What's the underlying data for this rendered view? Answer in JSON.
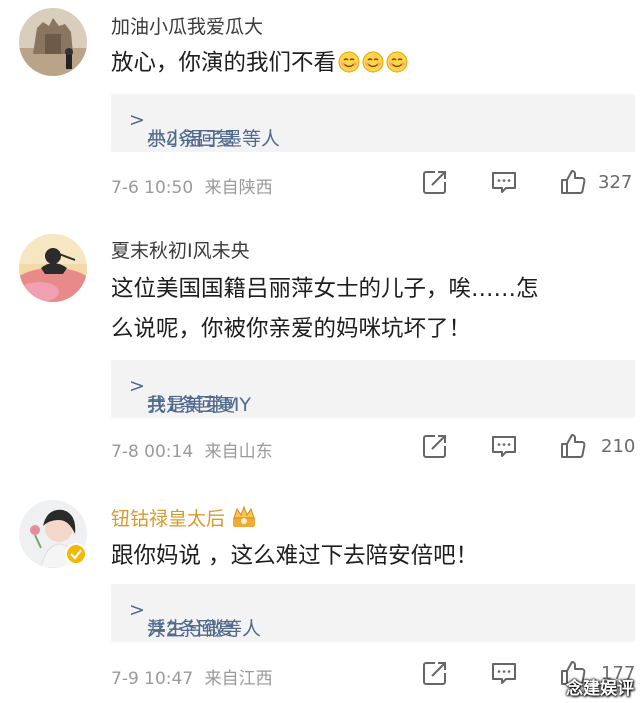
{
  "comments": [
    {
      "username": "加油小瓜我爱瓜大",
      "content": "放心，你演的我们不看",
      "emoji_count": 3,
      "replies_users": "小小温子墨等人",
      "replies_count": "共2条回复",
      "chevron": ">",
      "time": "7-6 10:50",
      "location": "来自陕西",
      "likes": "327"
    },
    {
      "username": "夏末秋初I风未央",
      "content_line1": "这位美国国籍吕丽萍女士的儿子，唉……怎",
      "content_line2": "么说呢，你被你亲爱的妈咪坑坏了！",
      "replies_users": "我是美芽MY",
      "replies_count": "共1条回复",
      "chevron": ">",
      "time": "7-8 00:14",
      "location": "来自山东",
      "likes": "210"
    },
    {
      "username": "钮钴禄皇太后",
      "content": "跟你妈说 ，这么难过下去陪安倍吧！",
      "replies_users": "浮生兮微等人",
      "replies_count": "共2条回复",
      "chevron": ">",
      "time": "7-9 10:47",
      "location": "来自江西",
      "likes": "177"
    }
  ],
  "watermark": "念建娱评",
  "colors": {
    "reply_link": "#516a8e",
    "meta": "#9a9a9a",
    "reply_box": "#f3f3f3",
    "vip_username": "#d79a2e",
    "verified_badge": "#f5b800"
  },
  "icons": [
    "avatar",
    "smile-emoji-icon",
    "share-icon",
    "comment-icon",
    "thumbs-up-icon",
    "crown-badge-icon",
    "verified-badge-icon"
  ]
}
